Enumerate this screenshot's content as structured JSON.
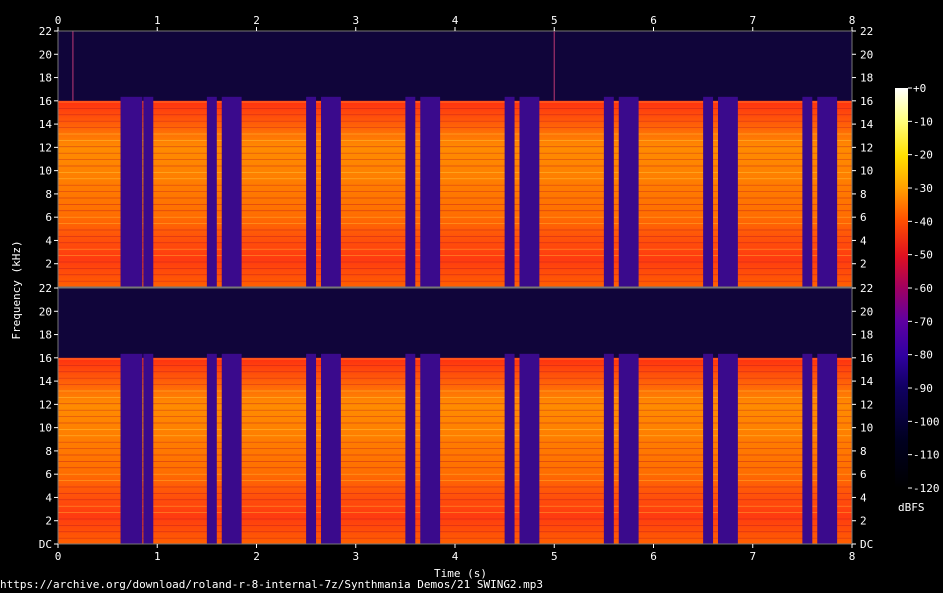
{
  "chart_data": {
    "type": "heatmap",
    "title": "",
    "xlabel": "Time (s)",
    "ylabel": "Frequency (kHz)",
    "x_ticks": [
      "0",
      "1",
      "2",
      "3",
      "4",
      "5",
      "6",
      "7",
      "8"
    ],
    "xlim": [
      0,
      8
    ],
    "channels": [
      {
        "y_ticks": [
          "22",
          "20",
          "18",
          "16",
          "14",
          "12",
          "10",
          "8",
          "6",
          "4",
          "2"
        ]
      },
      {
        "y_ticks": [
          "22",
          "20",
          "18",
          "16",
          "14",
          "12",
          "10",
          "8",
          "6",
          "4",
          "2",
          "DC"
        ]
      }
    ],
    "ylim_khz": [
      0,
      22
    ],
    "colorbar": {
      "label": "dBFS",
      "ticks": [
        "+0",
        "-10",
        "-20",
        "-30",
        "-40",
        "-50",
        "-60",
        "-70",
        "-80",
        "-90",
        "-100",
        "-110",
        "-120"
      ],
      "range_db": [
        -120,
        0
      ],
      "stops": [
        "#ffffff",
        "#ffff80",
        "#ffe000",
        "#ffa000",
        "#ff5000",
        "#e01020",
        "#a00060",
        "#6000a0",
        "#3000a0",
        "#100060",
        "#000020",
        "#000000"
      ]
    },
    "cutoff_khz": 16,
    "gap_intervals_s": [
      [
        0.63,
        0.85
      ],
      [
        0.86,
        0.96
      ],
      [
        1.5,
        1.6
      ],
      [
        1.65,
        1.85
      ],
      [
        2.5,
        2.6
      ],
      [
        2.65,
        2.85
      ],
      [
        3.5,
        3.6
      ],
      [
        3.65,
        3.85
      ],
      [
        4.5,
        4.6
      ],
      [
        4.65,
        4.85
      ],
      [
        5.5,
        5.6
      ],
      [
        5.65,
        5.85
      ],
      [
        6.5,
        6.6
      ],
      [
        6.65,
        6.85
      ],
      [
        7.5,
        7.6
      ],
      [
        7.65,
        7.85
      ]
    ],
    "transient_lines_s": [
      0.15,
      5.0
    ]
  },
  "footer": {
    "source_url": "https://archive.org/download/roland-r-8-internal-7z/Synthmania Demos/21 SWING2.mp3"
  }
}
